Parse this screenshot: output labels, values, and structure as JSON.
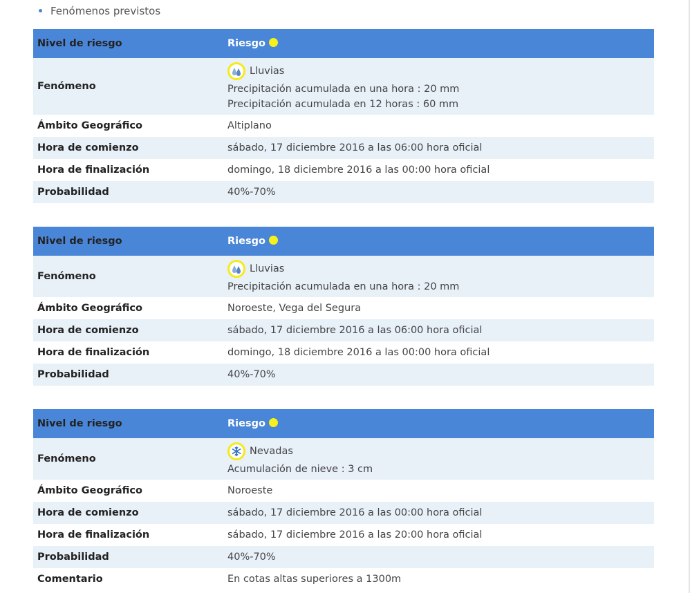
{
  "section": {
    "title": "Fenómenos previstos"
  },
  "colors": {
    "header_bg": "#4a86d8",
    "alt_row_bg": "#e8f0f8",
    "risk_yellow": "#f7f11b"
  },
  "warnings": [
    {
      "header": {
        "label": "Nivel de riesgo",
        "value": "Riesgo"
      },
      "phenomenon": {
        "label": "Fenómeno",
        "icon": "rain-drops-icon",
        "name": "Lluvias",
        "details": [
          "Precipitación acumulada en una hora : 20 mm",
          "Precipitación acumulada en 12 horas : 60 mm"
        ]
      },
      "rows": [
        {
          "label": "Ámbito Geográfico",
          "value": "Altiplano"
        },
        {
          "label": "Hora de comienzo",
          "value": "sábado, 17 diciembre 2016 a las 06:00 hora oficial"
        },
        {
          "label": "Hora de finalización",
          "value": "domingo, 18 diciembre 2016 a las 00:00 hora oficial"
        },
        {
          "label": "Probabilidad",
          "value": "40%-70%"
        }
      ]
    },
    {
      "header": {
        "label": "Nivel de riesgo",
        "value": "Riesgo"
      },
      "phenomenon": {
        "label": "Fenómeno",
        "icon": "rain-drops-icon",
        "name": "Lluvias",
        "details": [
          "Precipitación acumulada en una hora : 20 mm"
        ]
      },
      "rows": [
        {
          "label": "Ámbito Geográfico",
          "value": "Noroeste, Vega del Segura"
        },
        {
          "label": "Hora de comienzo",
          "value": "sábado, 17 diciembre 2016 a las 06:00 hora oficial"
        },
        {
          "label": "Hora de finalización",
          "value": "domingo, 18 diciembre 2016 a las 00:00 hora oficial"
        },
        {
          "label": "Probabilidad",
          "value": "40%-70%"
        }
      ]
    },
    {
      "header": {
        "label": "Nivel de riesgo",
        "value": "Riesgo"
      },
      "phenomenon": {
        "label": "Fenómeno",
        "icon": "snowflake-icon",
        "name": "Nevadas",
        "details": [
          "Acumulación de nieve : 3 cm"
        ]
      },
      "rows": [
        {
          "label": "Ámbito Geográfico",
          "value": "Noroeste"
        },
        {
          "label": "Hora de comienzo",
          "value": "sábado, 17 diciembre 2016 a las 00:00 hora oficial"
        },
        {
          "label": "Hora de finalización",
          "value": "sábado, 17 diciembre 2016 a las 20:00 hora oficial"
        },
        {
          "label": "Probabilidad",
          "value": "40%-70%"
        },
        {
          "label": "Comentario",
          "value": "En cotas altas superiores a 1300m"
        }
      ]
    }
  ]
}
